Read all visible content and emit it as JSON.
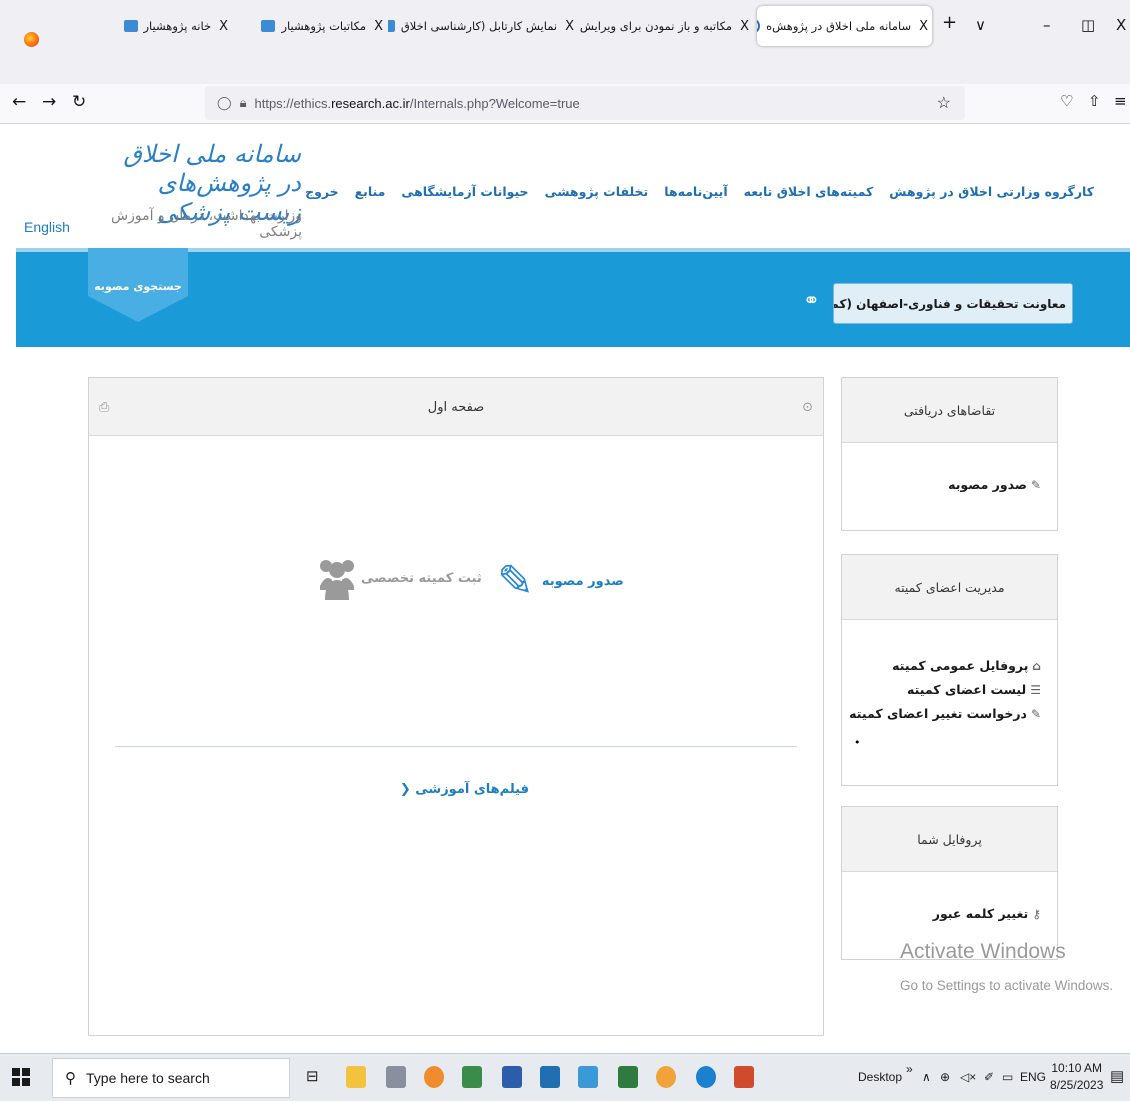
{
  "browser": {
    "tabs": [
      {
        "title": "خانه پژوهشیار",
        "close": "X"
      },
      {
        "title": "مکاتبات پژوهشیار",
        "close": "X"
      },
      {
        "title": "نمایش کارتابل (کارشناسی اخلاق",
        "close": "X"
      },
      {
        "title": "مکاتبه و باز نمودن برای ویرایش",
        "close": "X"
      },
      {
        "title": "سامانه ملی اخلاق در پژوهش‌ه",
        "close": "X"
      }
    ],
    "new_tab": "+",
    "tab_list": "∨",
    "window_minimize": "–",
    "window_restore": "◫",
    "window_close": "X",
    "url_prefix": "https://ethics.",
    "url_domain": "research.ac.ir",
    "url_path": "/Internals.php?Welcome=true"
  },
  "site": {
    "logo_text": "سامانه ملی اخلاق در پژوهش‌های زیست پزشکی",
    "logo_subtitle": "وزارت بهداشت، درمان و آموزش پزشکی",
    "language_link": "English",
    "nav": [
      "کارگروه وزارتی اخلاق در پژوهش",
      "کمیته‌های اخلاق تابعه",
      "آیین‌نامه‌ها",
      "تخلفات پژوهشی",
      "حیوانات آزمایشگاهی",
      "منابع",
      "خروج"
    ],
    "search_tab": "جستجوی مصوبه",
    "committee_label": "معاونت تحقیقات و فناوری-اصفهان (کمیته تخصصی"
  },
  "main": {
    "title": "صفحه اول",
    "approve_action": "صدور مصوبه",
    "register_action": "ثبت کمیته تخصصی",
    "films_link": "فیلم‌های آموزشی"
  },
  "sidebar": {
    "requests": {
      "title": "تقاضاهای دریافتی",
      "items": [
        "صدور مصوبه"
      ]
    },
    "members": {
      "title": "مدیریت اعضای کمیته",
      "items": [
        "پروفایل عمومی کمیته",
        "لیست اعضای کمیته",
        "درخواست تغییر اعضای کمیته"
      ]
    },
    "profile": {
      "title": "پروفایل شما",
      "items": [
        "تغییر کلمه عبور"
      ]
    }
  },
  "watermark": {
    "title": "Activate Windows",
    "subtitle": "Go to Settings to activate Windows."
  },
  "taskbar": {
    "search_placeholder": "Type here to search",
    "desktop_label": "Desktop",
    "language": "ENG",
    "time": "10:10 AM",
    "date": "8/25/2023"
  }
}
